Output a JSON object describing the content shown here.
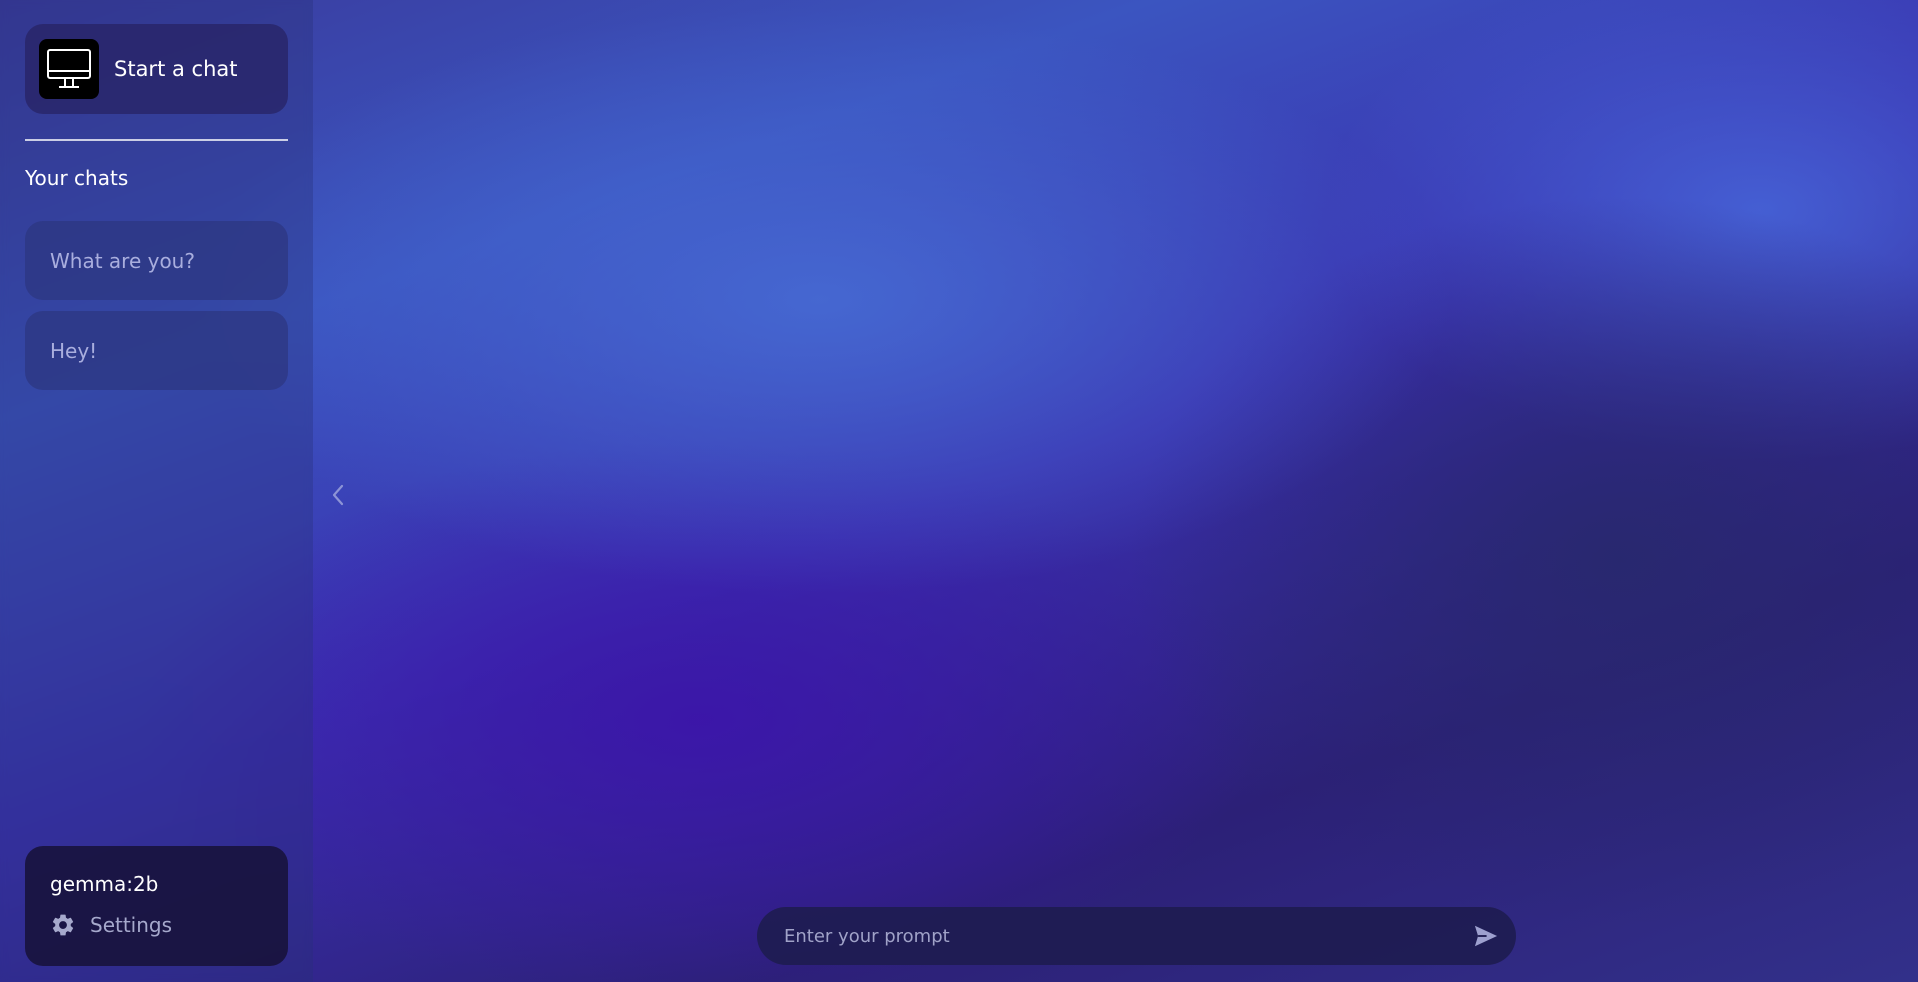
{
  "sidebar": {
    "start_chat_label": "Start a chat",
    "section_title": "Your chats",
    "chats": [
      {
        "label": "What are you?"
      },
      {
        "label": "Hey!"
      }
    ],
    "model_name": "gemma:2b",
    "settings_label": "Settings"
  },
  "prompt": {
    "placeholder": "Enter your prompt",
    "value": ""
  },
  "icons": {
    "start_chat": "monitor-icon",
    "collapse": "chevron-left-icon",
    "settings": "gear-icon",
    "send": "send-icon"
  },
  "colors": {
    "sidebar_text_muted": "#a9aede",
    "accent_blue": "#3b55c0",
    "deep_purple": "#3a2fae"
  }
}
